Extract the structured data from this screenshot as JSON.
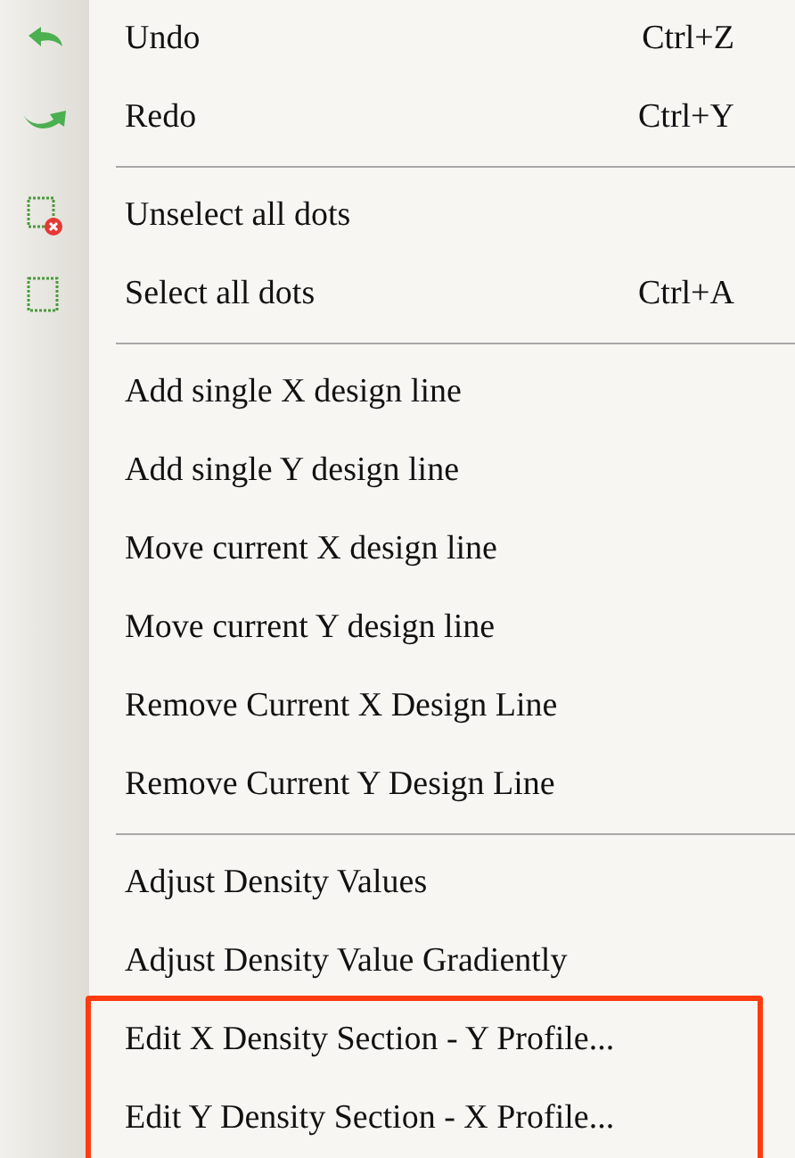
{
  "menu": {
    "sections": [
      {
        "items": [
          {
            "label": "Undo",
            "shortcut": "Ctrl+Z",
            "kind": "undo",
            "highlighted": false
          },
          {
            "label": "Redo",
            "shortcut": "Ctrl+Y",
            "kind": "redo",
            "highlighted": false
          }
        ]
      },
      {
        "items": [
          {
            "label": "Unselect all dots",
            "kind": "unselect",
            "highlighted": false
          },
          {
            "label": "Select all dots",
            "shortcut": "Ctrl+A",
            "kind": "select",
            "highlighted": false
          }
        ]
      },
      {
        "items": [
          {
            "label": "Add single X design line",
            "highlighted": false
          },
          {
            "label": "Add single Y design line",
            "highlighted": false
          },
          {
            "label": "Move current X design line",
            "highlighted": false
          },
          {
            "label": "Move current Y design line",
            "highlighted": false
          },
          {
            "label": "Remove Current X Design Line",
            "highlighted": false
          },
          {
            "label": "Remove Current Y Design Line",
            "highlighted": false
          }
        ]
      },
      {
        "items": [
          {
            "label": "Adjust Density Values",
            "highlighted": false
          },
          {
            "label": "Adjust Density Value Gradiently",
            "highlighted": false
          },
          {
            "label": "Edit X Density Section - Y Profile...",
            "highlighted": true
          },
          {
            "label": "Edit Y Density Section - X Profile...",
            "highlighted": true
          }
        ]
      }
    ]
  }
}
